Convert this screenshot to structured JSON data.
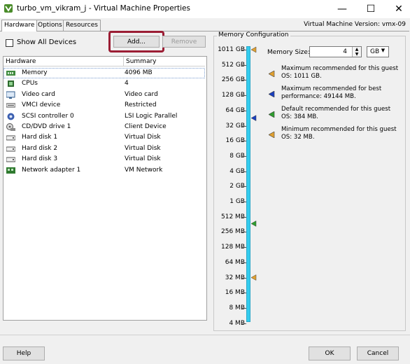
{
  "window": {
    "title": "turbo_vm_vikram_j - Virtual Machine Properties",
    "minimize": "—",
    "maximize": "☐",
    "close": "✕"
  },
  "tabs": [
    {
      "label": "Hardware",
      "active": true
    },
    {
      "label": "Options",
      "active": false
    },
    {
      "label": "Resources",
      "active": false
    }
  ],
  "vm_version": "Virtual Machine Version: vmx-09",
  "toolbar": {
    "show_all_devices": "Show All Devices",
    "show_all_checked": false,
    "add_label": "Add...",
    "remove_label": "Remove"
  },
  "hardware_table": {
    "columns": [
      "Hardware",
      "Summary"
    ],
    "rows": [
      {
        "name": "Memory",
        "summary": "4096 MB",
        "icon": "memory-icon",
        "selected": true
      },
      {
        "name": "CPUs",
        "summary": "4",
        "icon": "cpu-icon"
      },
      {
        "name": "Video card",
        "summary": "Video card",
        "icon": "video-card-icon"
      },
      {
        "name": "VMCI device",
        "summary": "Restricted",
        "icon": "vmci-device-icon"
      },
      {
        "name": "SCSI controller 0",
        "summary": "LSI Logic Parallel",
        "icon": "scsi-controller-icon"
      },
      {
        "name": "CD/DVD drive 1",
        "summary": "Client Device",
        "icon": "cd-dvd-icon"
      },
      {
        "name": "Hard disk 1",
        "summary": "Virtual Disk",
        "icon": "hard-disk-icon"
      },
      {
        "name": "Hard disk 2",
        "summary": "Virtual Disk",
        "icon": "hard-disk-icon"
      },
      {
        "name": "Hard disk 3",
        "summary": "Virtual Disk",
        "icon": "hard-disk-icon"
      },
      {
        "name": "Network adapter 1",
        "summary": "VM Network",
        "icon": "network-adapter-icon"
      }
    ]
  },
  "memory_config": {
    "title": "Memory Configuration",
    "scale_labels": [
      "1011 GB",
      "512 GB",
      "256 GB",
      "128 GB",
      "64 GB",
      "32 GB",
      "16 GB",
      "8 GB",
      "4 GB",
      "2 GB",
      "1 GB",
      "512 MB",
      "256 MB",
      "128 MB",
      "64 MB",
      "32 MB",
      "16 MB",
      "8 MB",
      "4 MB"
    ],
    "size_label": "Memory Size:",
    "size_value": "4",
    "unit_value": "GB",
    "legend": [
      {
        "text": "Maximum recommended for this guest OS: 1011 GB.",
        "color": "#e0a030",
        "icon": "max-recommended-icon"
      },
      {
        "text": "Maximum recommended for best performance: 49144 MB.",
        "color": "#1a3fbf",
        "icon": "best-performance-icon"
      },
      {
        "text": "Default recommended for this guest OS: 384 MB.",
        "color": "#2e9e2e",
        "icon": "default-recommended-icon"
      },
      {
        "text": "Minimum recommended for this guest OS: 32 MB.",
        "color": "#e0a030",
        "icon": "min-recommended-icon"
      }
    ],
    "markers": [
      {
        "name": "max-guest-marker",
        "at_label": "1011 GB",
        "color": "#e0a030"
      },
      {
        "name": "best-performance-marker",
        "at_label": "64 GB",
        "color": "#1a3fbf",
        "offset": 0.5
      },
      {
        "name": "default-marker",
        "at_label": "512 MB",
        "color": "#2e9e2e",
        "offset": 0.45
      },
      {
        "name": "min-marker",
        "at_label": "32 MB",
        "color": "#e0a030"
      }
    ]
  },
  "footer": {
    "help_label": "Help",
    "ok_label": "OK",
    "cancel_label": "Cancel"
  },
  "colors": {
    "scale_bar": "#33ccee",
    "add_highlight": "#9b1d34"
  }
}
